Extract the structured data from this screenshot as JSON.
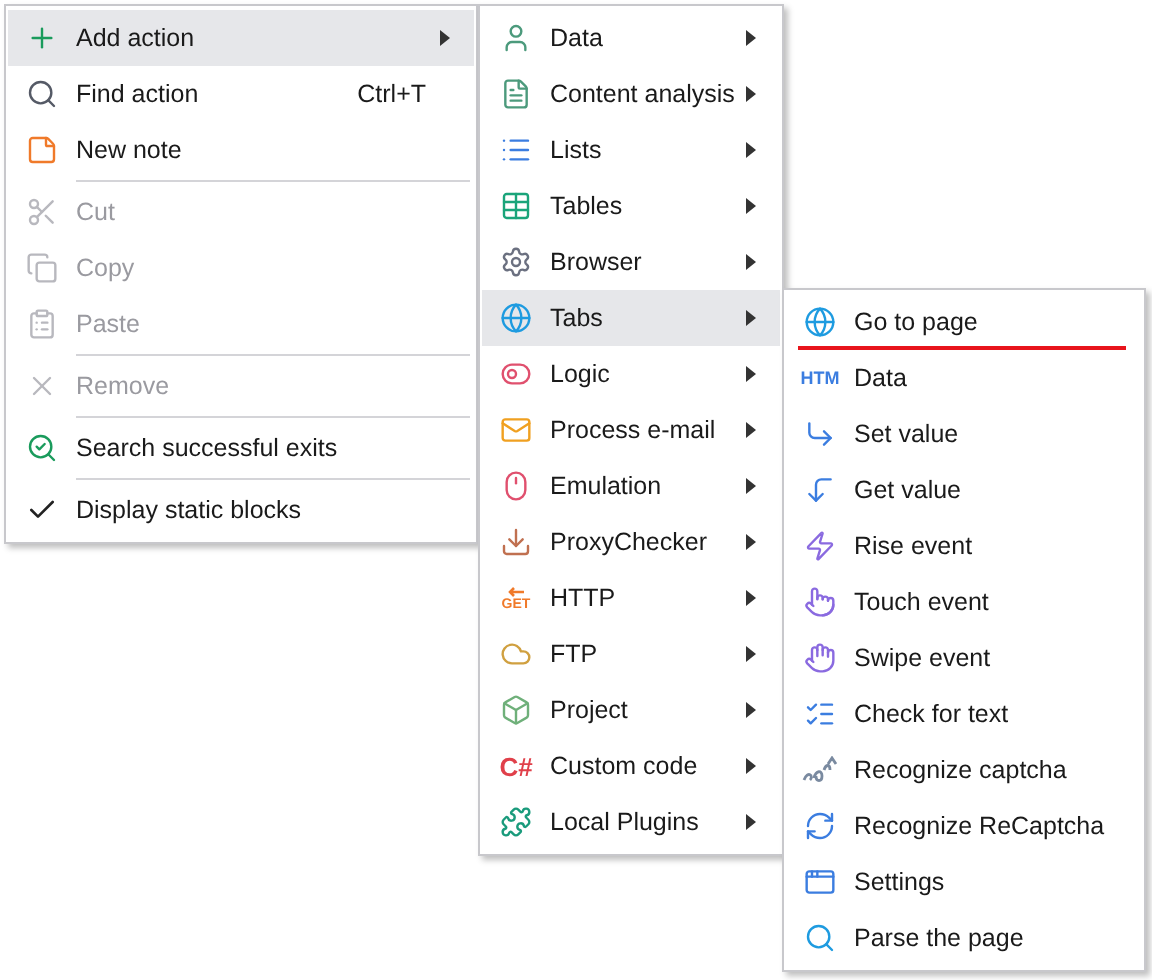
{
  "context_menu": {
    "items": [
      {
        "kind": "item",
        "label": "Add action",
        "selected": true,
        "disabled": false,
        "submenu": true
      },
      {
        "kind": "item",
        "label": "Find action",
        "shortcut": "Ctrl+T",
        "selected": false,
        "disabled": false
      },
      {
        "kind": "item",
        "label": "New note",
        "selected": false,
        "disabled": false
      },
      {
        "kind": "separator"
      },
      {
        "kind": "item",
        "label": "Cut",
        "selected": false,
        "disabled": true
      },
      {
        "kind": "item",
        "label": "Copy",
        "selected": false,
        "disabled": true
      },
      {
        "kind": "item",
        "label": "Paste",
        "selected": false,
        "disabled": true
      },
      {
        "kind": "separator"
      },
      {
        "kind": "item",
        "label": "Remove",
        "selected": false,
        "disabled": true
      },
      {
        "kind": "separator"
      },
      {
        "kind": "item",
        "label": "Search successful exits",
        "selected": false,
        "disabled": false
      },
      {
        "kind": "separator"
      },
      {
        "kind": "item",
        "label": "Display static blocks",
        "selected": false,
        "disabled": false,
        "checked": true
      }
    ]
  },
  "action_menu": {
    "items": [
      {
        "label": "Data",
        "selected": false
      },
      {
        "label": "Content analysis",
        "selected": false
      },
      {
        "label": "Lists",
        "selected": false
      },
      {
        "label": "Tables",
        "selected": false
      },
      {
        "label": "Browser",
        "selected": false
      },
      {
        "label": "Tabs",
        "selected": true
      },
      {
        "label": "Logic",
        "selected": false
      },
      {
        "label": "Process e-mail",
        "selected": false
      },
      {
        "label": "Emulation",
        "selected": false
      },
      {
        "label": "ProxyChecker",
        "selected": false
      },
      {
        "label": "HTTP",
        "selected": false,
        "icon_text": "GET"
      },
      {
        "label": "FTP",
        "selected": false
      },
      {
        "label": "Project",
        "selected": false
      },
      {
        "label": "Custom code",
        "selected": false,
        "icon_text": "C#"
      },
      {
        "label": "Local Plugins",
        "selected": false
      }
    ]
  },
  "tabs_menu": {
    "items": [
      {
        "label": "Go to page",
        "marked": true
      },
      {
        "label": "Data",
        "marked": false,
        "icon_text": "HTM"
      },
      {
        "label": "Set value",
        "marked": false
      },
      {
        "label": "Get value",
        "marked": false
      },
      {
        "label": "Rise event",
        "marked": false
      },
      {
        "label": "Touch event",
        "marked": false
      },
      {
        "label": "Swipe event",
        "marked": false
      },
      {
        "label": "Check for text",
        "marked": false
      },
      {
        "label": "Recognize captcha",
        "marked": false
      },
      {
        "label": "Recognize ReCaptcha",
        "marked": false
      },
      {
        "label": "Settings",
        "marked": false
      },
      {
        "label": "Parse the page",
        "marked": false
      }
    ]
  }
}
